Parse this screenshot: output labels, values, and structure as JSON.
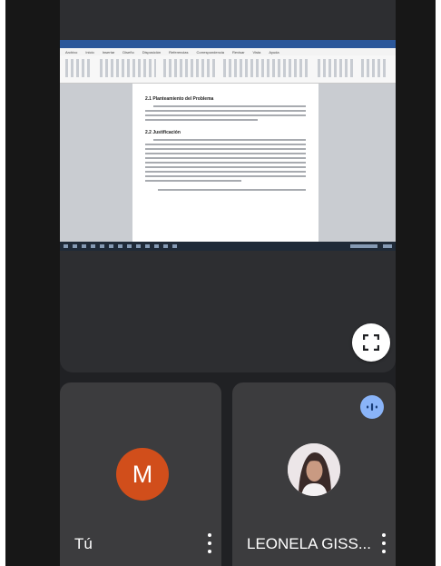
{
  "meeting": {
    "shared_screen": {
      "app": "Word",
      "ribbon_tabs": [
        "Archivo",
        "Inicio",
        "Insertar",
        "Diseño",
        "Disposición",
        "Referencias",
        "Correspondencia",
        "Revisar",
        "Vista",
        "Ayuda"
      ],
      "document": {
        "heading_1": "2.1 Planteamiento del Problema",
        "heading_2": "2.2 Justificación"
      }
    },
    "fullscreen_icon": "fullscreen-icon",
    "participants": [
      {
        "name": "Tú",
        "avatar_letter": "M",
        "avatar_color": "#d14e1b",
        "menu_icon": "more-vert-icon"
      },
      {
        "name": "LEONELA GISS...",
        "avatar_type": "photo",
        "menu_icon": "more-vert-icon",
        "speaking_icon": "audio-level-icon"
      }
    ]
  }
}
